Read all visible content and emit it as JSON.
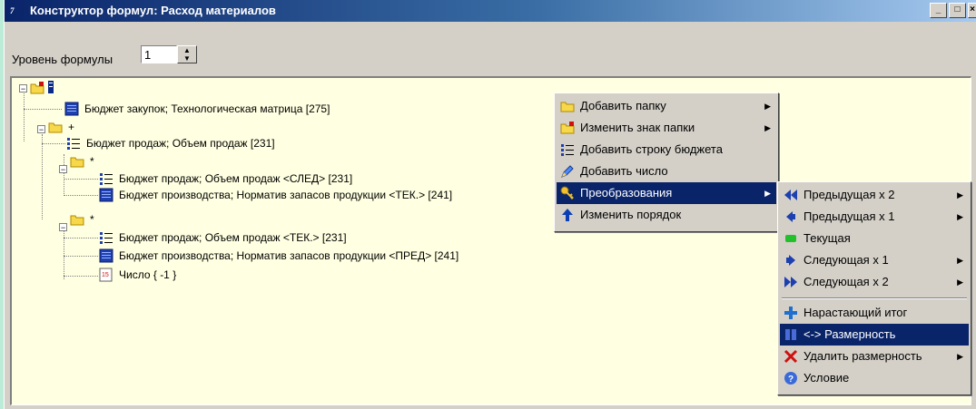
{
  "window": {
    "title": "Конструктор формул: Расход материалов",
    "app_icon_text": "7",
    "controls": [
      "minimize-icon",
      "maximize-icon",
      "close-icon"
    ],
    "titlebar_color": "#0a246a"
  },
  "toolbar": {
    "level_label": "Уровень формулы",
    "level_value": "1"
  },
  "tree": {
    "background": "#ffffe1",
    "items": [
      {
        "label": "Бюджет закупок;  Технологическая матрица   [275]",
        "icon": "budget-table-icon"
      },
      {
        "label": "+",
        "icon": "folder-icon"
      },
      {
        "label": "Бюджет продаж;  Объем продаж   [231]",
        "icon": "budget-row-icon"
      },
      {
        "label": "*",
        "icon": "folder-icon"
      },
      {
        "label": "Бюджет продаж;  Объем продаж   <СЛЕД>  [231]",
        "icon": "budget-row-icon"
      },
      {
        "label": "Бюджет производства;  Норматив запасов продукции   <ТЕК.>  [241]",
        "icon": "budget-table-icon"
      },
      {
        "label": "*",
        "icon": "folder-icon"
      },
      {
        "label": "Бюджет продаж;  Объем продаж   <ТЕК.>  [231]",
        "icon": "budget-row-icon"
      },
      {
        "label": "Бюджет производства;  Норматив запасов продукции   <ПРЕД>  [241]",
        "icon": "budget-table-icon"
      },
      {
        "label": "Число { -1 }",
        "icon": "number-icon",
        "icon_text": "15"
      }
    ]
  },
  "context_menu": {
    "items": [
      {
        "label": "Добавить папку",
        "icon": "folder-icon",
        "submenu": true
      },
      {
        "label": "Изменить знак папки",
        "icon": "folder-sign-icon",
        "submenu": true
      },
      {
        "label": "Добавить строку бюджета",
        "icon": "budget-row-icon",
        "submenu": false
      },
      {
        "label": "Добавить число",
        "icon": "pencil-icon",
        "submenu": false
      },
      {
        "label": "Преобразования",
        "icon": "key-icon",
        "submenu": true,
        "selected": true
      },
      {
        "label": "Изменить порядок",
        "icon": "arrow-up-icon",
        "submenu": false
      }
    ]
  },
  "submenu": {
    "items": [
      {
        "label": "Предыдущая х 2",
        "icon": "double-left-icon",
        "submenu": true
      },
      {
        "label": "Предыдущая х 1",
        "icon": "left-icon",
        "submenu": true
      },
      {
        "label": "Текущая",
        "icon": "current-icon",
        "submenu": false
      },
      {
        "label": "Следующая х 1",
        "icon": "right-icon",
        "submenu": true
      },
      {
        "label": "Следующая х 2",
        "icon": "double-right-icon",
        "submenu": true
      },
      {
        "label": "Нарастающий итог",
        "icon": "plus-icon",
        "submenu": false
      },
      {
        "label": "<-> Размерность",
        "icon": "dimension-icon",
        "submenu": false,
        "selected": true
      },
      {
        "label": "Удалить размерность",
        "icon": "delete-icon",
        "submenu": true
      },
      {
        "label": "Условие",
        "icon": "help-icon",
        "submenu": false
      }
    ]
  },
  "colors": {
    "selection": "#0a246a",
    "accent_blue": "#0a3fb5",
    "green": "#22c02a",
    "red": "#d01010"
  }
}
